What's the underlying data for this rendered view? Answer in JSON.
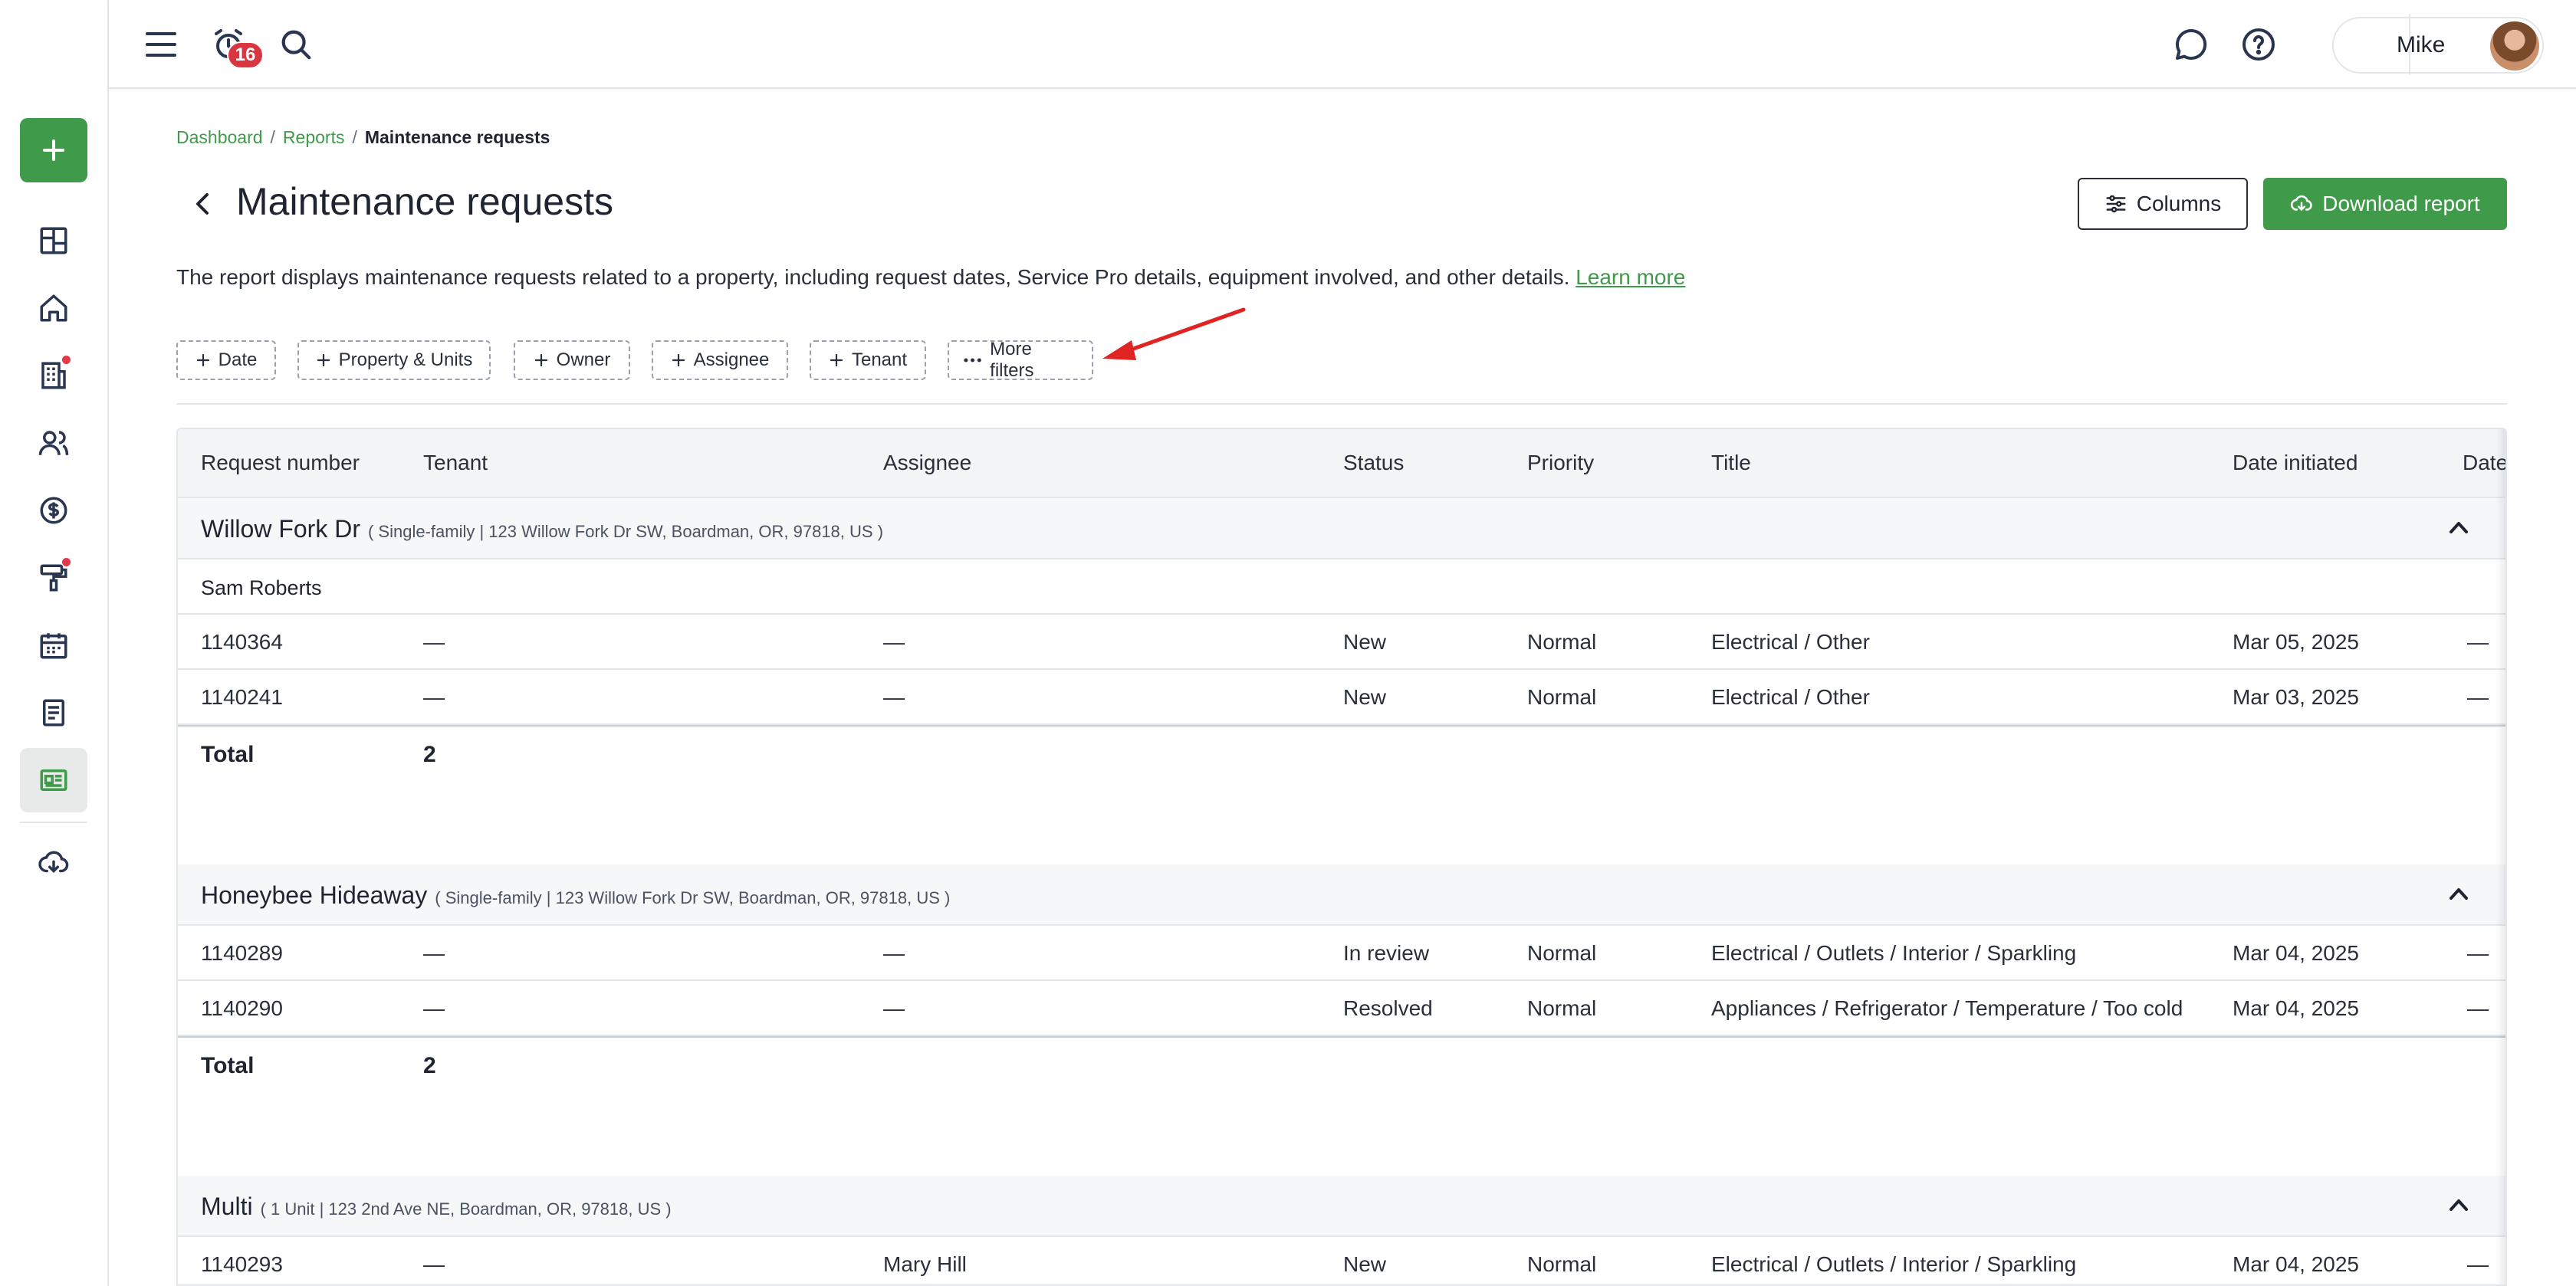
{
  "topbar": {
    "notification_count": "16",
    "user_name": "Mike"
  },
  "breadcrumb": {
    "items": [
      "Dashboard",
      "Reports"
    ],
    "current": "Maintenance requests"
  },
  "page": {
    "title": "Maintenance requests",
    "description": "The report displays maintenance requests related to a property, including request dates, Service Pro details, equipment involved, and other details.",
    "learn_more": "Learn more"
  },
  "actions": {
    "columns_label": "Columns",
    "download_label": "Download report"
  },
  "filters": [
    "Date",
    "Property & Units",
    "Owner",
    "Assignee",
    "Tenant"
  ],
  "more_filters_label": "More filters",
  "table": {
    "headers": [
      "Request number",
      "Tenant",
      "Assignee",
      "Status",
      "Priority",
      "Title",
      "Date initiated",
      "Date"
    ],
    "total_label": "Total",
    "groups": [
      {
        "name": "Willow Fork Dr",
        "detail": "( Single-family | 123 Willow Fork Dr SW, Boardman, OR, 97818, US )",
        "subheader": "Sam Roberts",
        "rows": [
          [
            "1140364",
            "—",
            "—",
            "New",
            "Normal",
            "Electrical / Other",
            "Mar 05, 2025",
            "—"
          ],
          [
            "1140241",
            "—",
            "—",
            "New",
            "Normal",
            "Electrical / Other",
            "Mar 03, 2025",
            "—"
          ]
        ],
        "total": "2"
      },
      {
        "name": "Honeybee Hideaway",
        "detail": "( Single-family | 123 Willow Fork Dr SW, Boardman, OR, 97818, US )",
        "rows": [
          [
            "1140289",
            "—",
            "—",
            "In review",
            "Normal",
            "Electrical / Outlets / Interior / Sparkling",
            "Mar 04, 2025",
            "—"
          ],
          [
            "1140290",
            "—",
            "—",
            "Resolved",
            "Normal",
            "Appliances / Refrigerator / Temperature / Too cold",
            "Mar 04, 2025",
            "—"
          ]
        ],
        "total": "2"
      },
      {
        "name": "Multi",
        "detail": "( 1 Unit | 123 2nd Ave NE, Boardman, OR, 97818, US )",
        "rows": [
          [
            "1140293",
            "—",
            "Mary Hill",
            "New",
            "Normal",
            "Electrical / Outlets / Interior / Sparkling",
            "Mar 04, 2025",
            "—"
          ]
        ]
      }
    ]
  },
  "colors": {
    "brand_green": "#3f9a4a",
    "badge_red": "#d9373f",
    "annotation_arrow": "#e02424"
  }
}
